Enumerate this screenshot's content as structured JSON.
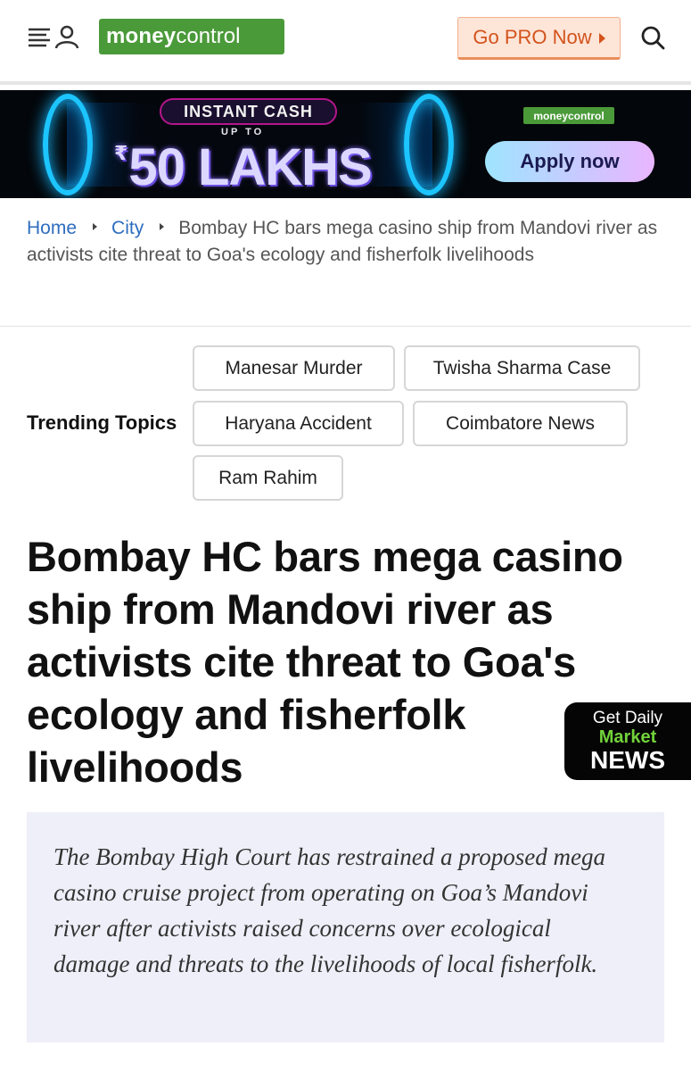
{
  "header": {
    "logo": {
      "part1": "money",
      "part2": "control"
    },
    "pro_button": "Go PRO Now",
    "brand_color": "#4b9a3a",
    "accent_color": "#d3531b"
  },
  "banner": {
    "tag": "INSTANT CASH",
    "upto": "UP TO",
    "currency": "₹",
    "amount": "50 LAKHS",
    "logo_text": "moneycontrol",
    "cta": "Apply now"
  },
  "breadcrumb": {
    "home": "Home",
    "section": "City",
    "current": "Bombay HC bars mega casino ship from Mandovi river as activists cite threat to Goa's ecology and fisherfolk livelihoods"
  },
  "trending": {
    "label": "Trending Topics",
    "topics": [
      "Manesar Murder",
      "Twisha Sharma Case",
      "Haryana Accident",
      "Coimbatore News",
      "Ram Rahim"
    ]
  },
  "article": {
    "headline": "Bombay HC bars mega casino ship from Mandovi river as activists cite threat to Goa's ecology and fisherfolk livelihoods",
    "summary": "The Bombay High Court has restrained a proposed mega casino cruise project from operating on Goa’s Mandovi river after activists raised concerns over ecological damage and threats to the livelihoods of local fisherfolk."
  },
  "news_badge": {
    "line1": "Get Daily",
    "line2": "Market",
    "line3": "NEWS"
  }
}
